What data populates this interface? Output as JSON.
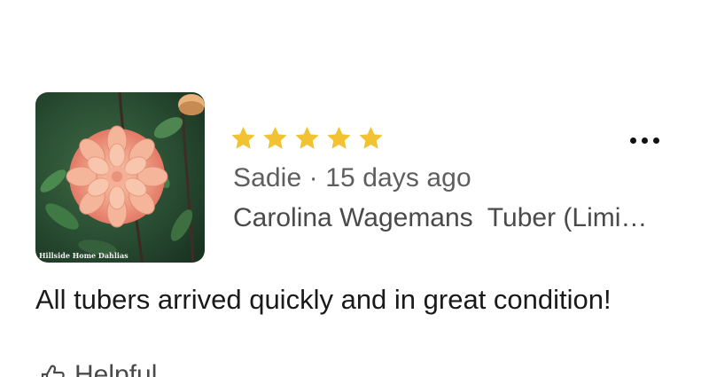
{
  "review": {
    "photo": {
      "alt": "Peach dahlia flower",
      "watermark": "Hillside Home Dahlias"
    },
    "rating": 5,
    "rating_max": 5,
    "star_color": "#F1C232",
    "reviewer_line": "Sadie · 15 days ago",
    "product_title": "Carolina Wagemans  Tuber (Limi…",
    "text": "All tubers arrived quickly and in great condition!",
    "helpful_label": "Helpful",
    "more_icon": "more-horizontal-icon"
  }
}
